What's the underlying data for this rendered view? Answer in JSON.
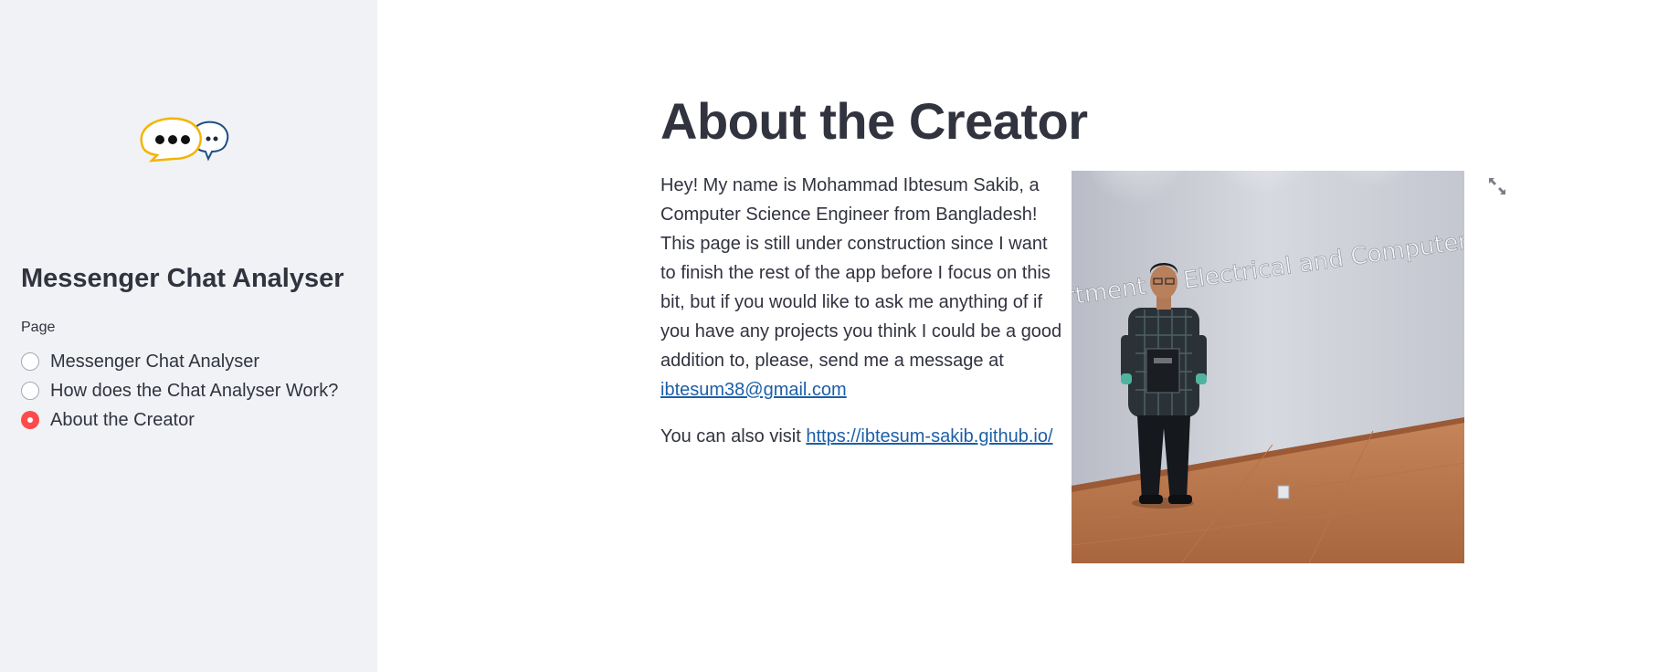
{
  "sidebar": {
    "logo_icon": "chat-bubbles-icon",
    "title": "Messenger Chat Analyser",
    "radio_label": "Page",
    "options": [
      {
        "label": "Messenger Chat Analyser",
        "selected": false
      },
      {
        "label": "How does the Chat Analyser Work?",
        "selected": false
      },
      {
        "label": "About the Creator",
        "selected": true
      }
    ]
  },
  "main": {
    "title": "About the Creator",
    "bio_text": "Hey! My name is Mohammad Ibtesum Sakib, a Computer Science Engineer from Bangladesh! This page is still under construction since I want to finish the rest of the app before I focus on this bit, but if you would like to ask me anything of if you have any projects you think I could be a good addition to, please, send me a message at ",
    "email": "ibtesum38@gmail.com",
    "visit_text": "You can also visit ",
    "website": "https://ibtesum-sakib.github.io/",
    "photo_wall_text": "rtment of Electrical and Computer Engineering",
    "expand_icon": "fullscreen-expand-icon"
  },
  "colors": {
    "sidebar_bg": "#f0f2f6",
    "accent": "#ff4b4b",
    "link": "#1c5fa8",
    "text": "#31333f"
  }
}
